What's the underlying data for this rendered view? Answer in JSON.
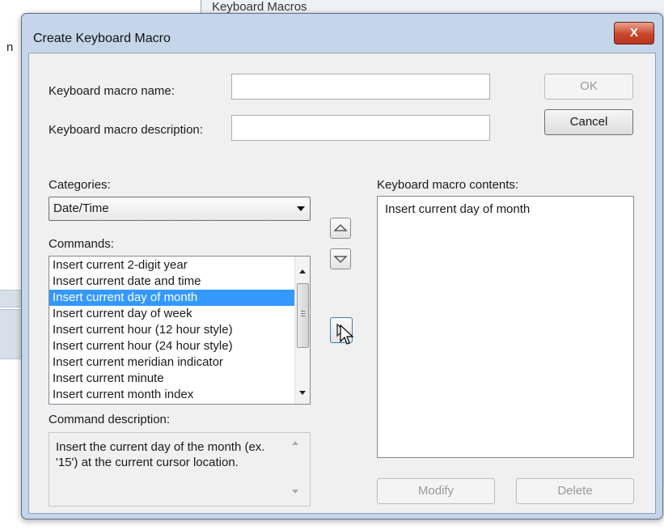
{
  "background": {
    "window_title": "Keyboard Macros"
  },
  "dialog": {
    "title": "Create Keyboard Macro",
    "close_label": "X",
    "name_label": "Keyboard macro name:",
    "name_value": "",
    "description_label": "Keyboard macro description:",
    "description_value": "",
    "ok_label": "OK",
    "cancel_label": "Cancel",
    "categories_label": "Categories:",
    "category_selected": "Date/Time",
    "commands_label": "Commands:",
    "commands": [
      "Insert current 2-digit year",
      "Insert current date and time",
      "Insert current day of month",
      "Insert current day of week",
      "Insert current hour (12 hour style)",
      "Insert current hour (24 hour style)",
      "Insert current meridian indicator",
      "Insert current minute",
      "Insert current month index"
    ],
    "selected_command_index": 2,
    "command_description_label": "Command description:",
    "command_description": "Insert the current day of the month (ex. '15') at the current cursor location.",
    "contents_label": "Keyboard macro contents:",
    "contents_items": [
      "Insert current day of month"
    ],
    "modify_label": "Modify",
    "delete_label": "Delete"
  },
  "colors": {
    "selection": "#3399ff",
    "close_button": "#c9452c",
    "dialog_frame": "#c5d6ea"
  },
  "icons": [
    "move-up-icon",
    "move-down-icon",
    "add-to-macro-icon",
    "mouse-cursor-icon"
  ]
}
